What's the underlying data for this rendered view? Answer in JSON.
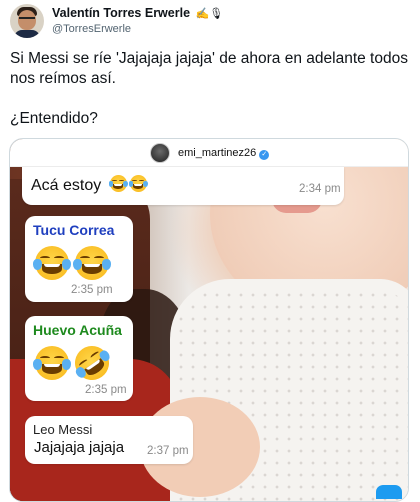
{
  "tweet": {
    "author_name": "Valentín Torres Erwerle",
    "author_emojis": "✍️🎙",
    "handle": "@TorresErwerle",
    "text_line1": "Si Messi se ríe 'Jajajaja jajaja' de ahora en adelante todos nos reímos así.",
    "text_line2": "¿Entendido?"
  },
  "media": {
    "ig_username": "emi_martinez26",
    "verified_icon": "verified-check-icon",
    "messages": [
      {
        "sender": "",
        "text": "Acá estoy",
        "emojis": [
          "tears-of-joy-icon",
          "tears-of-joy-icon"
        ],
        "time": "2:34 pm"
      },
      {
        "sender": "Tucu Correa",
        "sender_color": "#1f3fbf",
        "text": "",
        "emojis": [
          "tears-of-joy-icon",
          "tears-of-joy-icon"
        ],
        "time": "2:35 pm"
      },
      {
        "sender": "Huevo Acuña",
        "sender_color": "#1e8a1e",
        "text": "",
        "emojis": [
          "tears-of-joy-icon",
          "rolling-on-floor-laughing-icon"
        ],
        "time": "2:35 pm"
      },
      {
        "sender": "Leo Messi",
        "sender_color": "#222222",
        "text": "Jajajaja jajaja",
        "emojis": [],
        "time": "2:37 pm"
      }
    ]
  },
  "colors": {
    "verified_blue": "#3897f0",
    "twitter_blue": "#1d9bf0"
  }
}
